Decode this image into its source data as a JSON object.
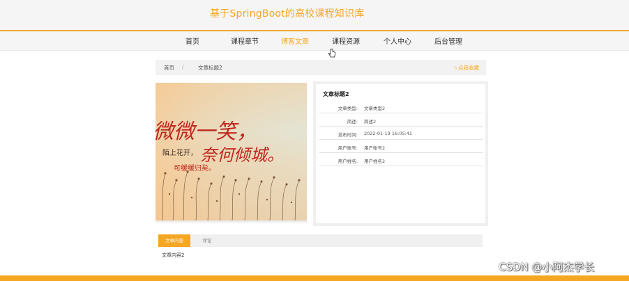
{
  "site": {
    "title": "基于SpringBoot的高校课程知识库"
  },
  "nav": {
    "items": [
      {
        "label": "首页"
      },
      {
        "label": "课程章节"
      },
      {
        "label": "博客文章"
      },
      {
        "label": "课程资源"
      },
      {
        "label": "个人中心"
      },
      {
        "label": "后台管理"
      }
    ],
    "active": "博客文章"
  },
  "breadcrumb": {
    "home": "首页",
    "separator": "/",
    "current": "文章标题2"
  },
  "favorite": {
    "icon": "star-outline-icon",
    "label": "☆点我收藏"
  },
  "cover": {
    "calligraphy_main": "微微一笑，",
    "calligraphy_second": "奈何倾城。",
    "line1": "陌上花开，",
    "line2": "可缓缓归矣。"
  },
  "article": {
    "title": "文章标题2",
    "fields": [
      {
        "label": "文章类型:",
        "value": "文章类型2"
      },
      {
        "label": "简述:",
        "value": "简述2"
      },
      {
        "label": "发布时间:",
        "value": "2022-01-19 16:05:41"
      },
      {
        "label": "用户账号:",
        "value": "用户账号2"
      },
      {
        "label": "用户姓名:",
        "value": "用户姓名2"
      }
    ]
  },
  "tabs": {
    "items": [
      {
        "label": "文章内容"
      },
      {
        "label": "评论"
      }
    ],
    "active": "文章内容",
    "content": "文章内容2"
  },
  "watermark": {
    "text": "CSDN @小阿杰学长"
  },
  "colors": {
    "accent": "#f5a623",
    "nav_bg": "#f5f5f5",
    "text": "#333333"
  }
}
